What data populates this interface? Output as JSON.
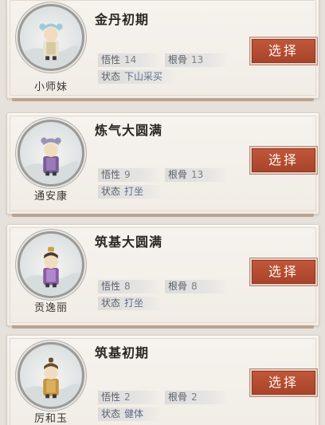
{
  "disciples": [
    {
      "name": "小师妹",
      "realm": "金丹初期",
      "wuxing_label": "悟性",
      "wuxing": "14",
      "gengu_label": "根骨",
      "gengu": "13",
      "state_label": "状态",
      "state": "下山采买",
      "button": "选择",
      "robe_color": "#e7e2cf",
      "accent_color": "#9ecbd6"
    },
    {
      "name": "通安康",
      "realm": "炼气大圆满",
      "wuxing_label": "悟性",
      "wuxing": "9",
      "gengu_label": "根骨",
      "gengu": "13",
      "state_label": "状态",
      "state": "打坐",
      "button": "选择",
      "robe_color": "#7b5a9a",
      "accent_color": "#9a93b5"
    },
    {
      "name": "贡逸丽",
      "realm": "筑基大圆满",
      "wuxing_label": "悟性",
      "wuxing": "8",
      "gengu_label": "根骨",
      "gengu": "8",
      "state_label": "状态",
      "state": "打坐",
      "button": "选择",
      "robe_color": "#8a5aa8",
      "accent_color": "#c9a04a"
    },
    {
      "name": "厉和玉",
      "realm": "筑基初期",
      "wuxing_label": "悟性",
      "wuxing": "2",
      "gengu_label": "根骨",
      "gengu": "2",
      "state_label": "状态",
      "state": "健体",
      "button": "选择",
      "robe_color": "#c7923a",
      "accent_color": "#6a4a2a"
    }
  ]
}
